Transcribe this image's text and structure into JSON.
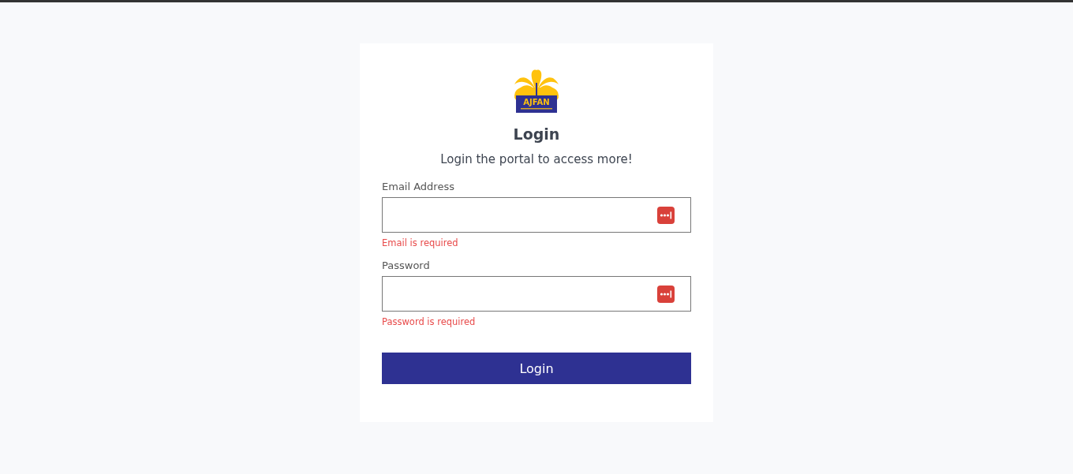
{
  "logo": {
    "text": "AJFAN"
  },
  "title": "Login",
  "subtitle": "Login the portal to access more!",
  "fields": [
    {
      "label": "Email Address",
      "error": "Email is required"
    },
    {
      "label": "Password",
      "error": "Password is required"
    }
  ],
  "submit": "Login"
}
